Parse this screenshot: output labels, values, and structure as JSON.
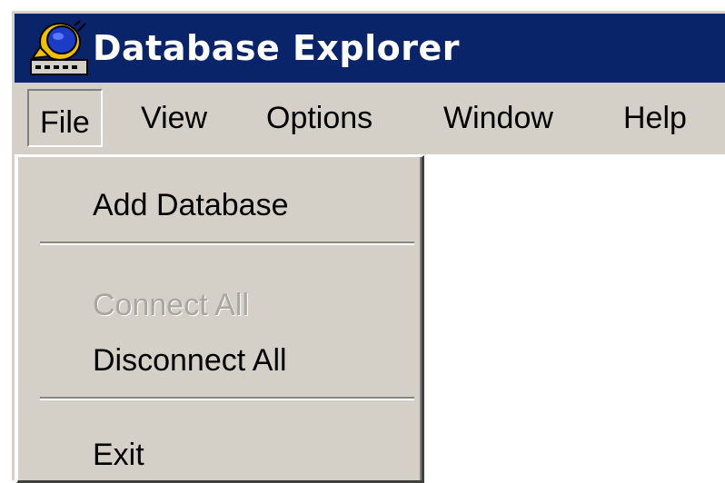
{
  "window": {
    "title": "Database Explorer",
    "icon": "database-explorer-app-icon"
  },
  "menubar": {
    "items": [
      {
        "label": "File",
        "open": true
      },
      {
        "label": "View"
      },
      {
        "label": "Options"
      },
      {
        "label": "Window"
      },
      {
        "label": "Help"
      }
    ]
  },
  "file_menu": {
    "add_database": "Add Database",
    "connect_all": "Connect All",
    "disconnect_all": "Disconnect All",
    "exit": "Exit"
  },
  "colors": {
    "titlebar": "#0a246a",
    "menu_face": "#d4d0c8",
    "disabled_text": "#a9a6a0"
  }
}
